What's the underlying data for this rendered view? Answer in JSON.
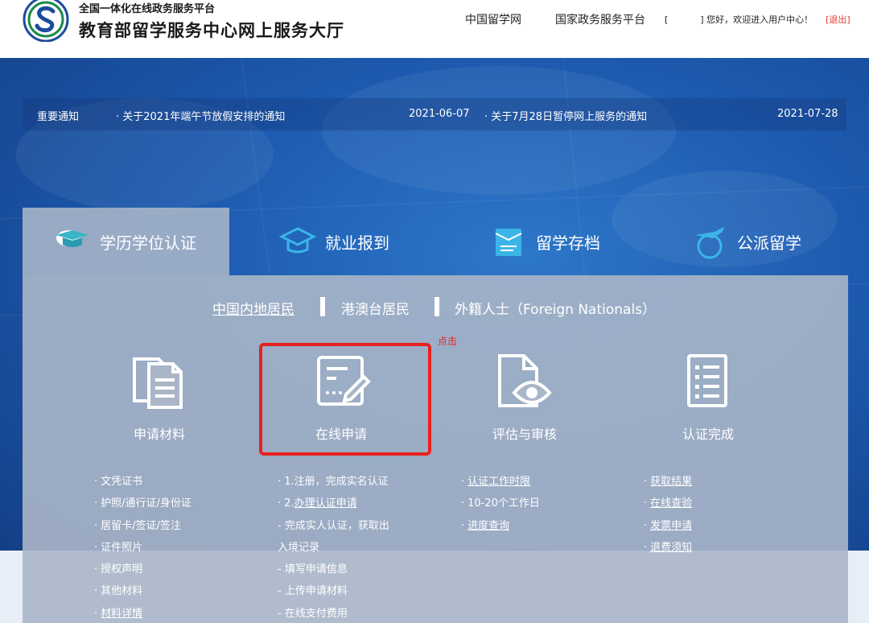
{
  "header": {
    "platform_subtitle": "全国一体化在线政务服务平台",
    "site_title": "教育部留学服务中心网上服务大厅",
    "nav_links": [
      "中国留学网",
      "国家政务服务平台"
    ],
    "user_bracket_open": "[",
    "user_welcome": "] 您好，欢迎进入用户中心！",
    "logout_label": "[退出]"
  },
  "notice": {
    "label": "重要通知",
    "items": [
      {
        "title": "· 关于2021年端午节放假安排的通知",
        "date": "2021-06-07"
      },
      {
        "title": "· 关于7月28日暂停网上服务的通知",
        "date": "2021-07-28"
      }
    ]
  },
  "tabs": [
    {
      "label": "学历学位认证",
      "icon": "graduation-cap-icon"
    },
    {
      "label": "就业报到",
      "icon": "hat-icon"
    },
    {
      "label": "留学存档",
      "icon": "file-folder-icon"
    },
    {
      "label": "公派留学",
      "icon": "airplane-globe-icon"
    }
  ],
  "residency": [
    "中国内地居民",
    "港澳台居民",
    "外籍人士（Foreign Nationals）"
  ],
  "steps": [
    {
      "label": "申请材料",
      "icon": "documents-icon"
    },
    {
      "label": "在线申请",
      "icon": "edit-form-icon"
    },
    {
      "label": "评估与审核",
      "icon": "document-eye-icon"
    },
    {
      "label": "认证完成",
      "icon": "checklist-icon"
    }
  ],
  "annotation": {
    "click_note": "点击"
  },
  "columns": {
    "materials": [
      "文凭证书",
      "护照/通行证/身份证",
      "居留卡/签证/签注",
      "证件照片",
      "授权声明",
      "其他材料",
      "材料详情"
    ],
    "online": [
      "· 1.注册，完成实名认证",
      "· 2.",
      "办理认证申请",
      "- 完成实人认证，获取出",
      "入境记录",
      "- 填写申请信息",
      "- 上传申请材料",
      "- 在线支付费用"
    ],
    "review": [
      "认证工作时限",
      "10-20个工作日",
      "进度查询"
    ],
    "complete": [
      "获取结果",
      "在线查验",
      "发票申请",
      "退费须知"
    ]
  },
  "colors": {
    "accent_red": "#e8211f",
    "hero_blue": "#1d5bb0",
    "panel_gray": "#aab6c8"
  }
}
